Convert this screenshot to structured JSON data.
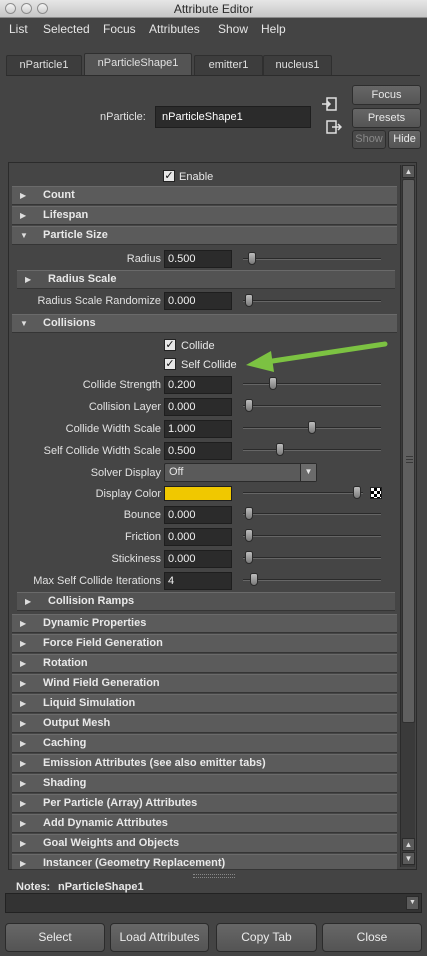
{
  "window": {
    "title": "Attribute Editor"
  },
  "menu": [
    "List",
    "Selected",
    "Focus",
    "Attributes",
    "Show",
    "Help"
  ],
  "tabs": [
    "nParticle1",
    "nParticleShape1",
    "emitter1",
    "nucleus1"
  ],
  "active_tab": "nParticleShape1",
  "header": {
    "node_label": "nParticle:",
    "node_value": "nParticleShape1",
    "focus": "Focus",
    "presets": "Presets",
    "show": "Show",
    "hide": "Hide"
  },
  "enable": {
    "label": "Enable",
    "checked": true
  },
  "sections": {
    "count": "Count",
    "lifespan": "Lifespan",
    "particle_size": "Particle Size",
    "radius_scale": "Radius Scale",
    "collisions": "Collisions",
    "collision_ramps": "Collision Ramps",
    "collapsed": [
      "Dynamic Properties",
      "Force Field Generation",
      "Rotation",
      "Wind Field Generation",
      "Liquid Simulation",
      "Output Mesh",
      "Caching",
      "Emission Attributes (see also emitter tabs)",
      "Shading",
      "Per Particle (Array) Attributes",
      "Add Dynamic Attributes",
      "Goal Weights and Objects",
      "Instancer (Geometry Replacement)"
    ]
  },
  "particle_size": {
    "radius": {
      "label": "Radius",
      "value": "0.500",
      "slider": 0.05
    },
    "radius_scale_randomize": {
      "label": "Radius Scale Randomize",
      "value": "0.000",
      "slider": 0.0
    }
  },
  "collisions": {
    "collide": {
      "label": "Collide",
      "checked": true
    },
    "self_collide": {
      "label": "Self Collide",
      "checked": true
    },
    "collide_strength": {
      "label": "Collide Strength",
      "value": "0.200",
      "slider": 0.2
    },
    "collision_layer": {
      "label": "Collision Layer",
      "value": "0.000",
      "slider": 0.0
    },
    "collide_width_scale": {
      "label": "Collide Width Scale",
      "value": "1.000",
      "slider": 0.5
    },
    "self_collide_width_scale": {
      "label": "Self Collide Width Scale",
      "value": "0.500",
      "slider": 0.25
    },
    "solver_display": {
      "label": "Solver Display",
      "value": "Off"
    },
    "display_color": {
      "label": "Display Color",
      "color": "#f0c800",
      "slider": 0.83
    },
    "bounce": {
      "label": "Bounce",
      "value": "0.000",
      "slider": 0.0
    },
    "friction": {
      "label": "Friction",
      "value": "0.000",
      "slider": 0.0
    },
    "stickiness": {
      "label": "Stickiness",
      "value": "0.000",
      "slider": 0.0
    },
    "max_self_collide_iterations": {
      "label": "Max Self Collide Iterations",
      "value": "4",
      "slider": 0.04
    }
  },
  "notes": {
    "label": "Notes:",
    "value": "nParticleShape1"
  },
  "bottom_buttons": {
    "select": "Select",
    "load_attributes": "Load Attributes",
    "copy_tab": "Copy Tab",
    "close": "Close"
  },
  "icons": {
    "arrow_annotation": "green-arrow-icon",
    "arrow_color": "#7cc242"
  }
}
